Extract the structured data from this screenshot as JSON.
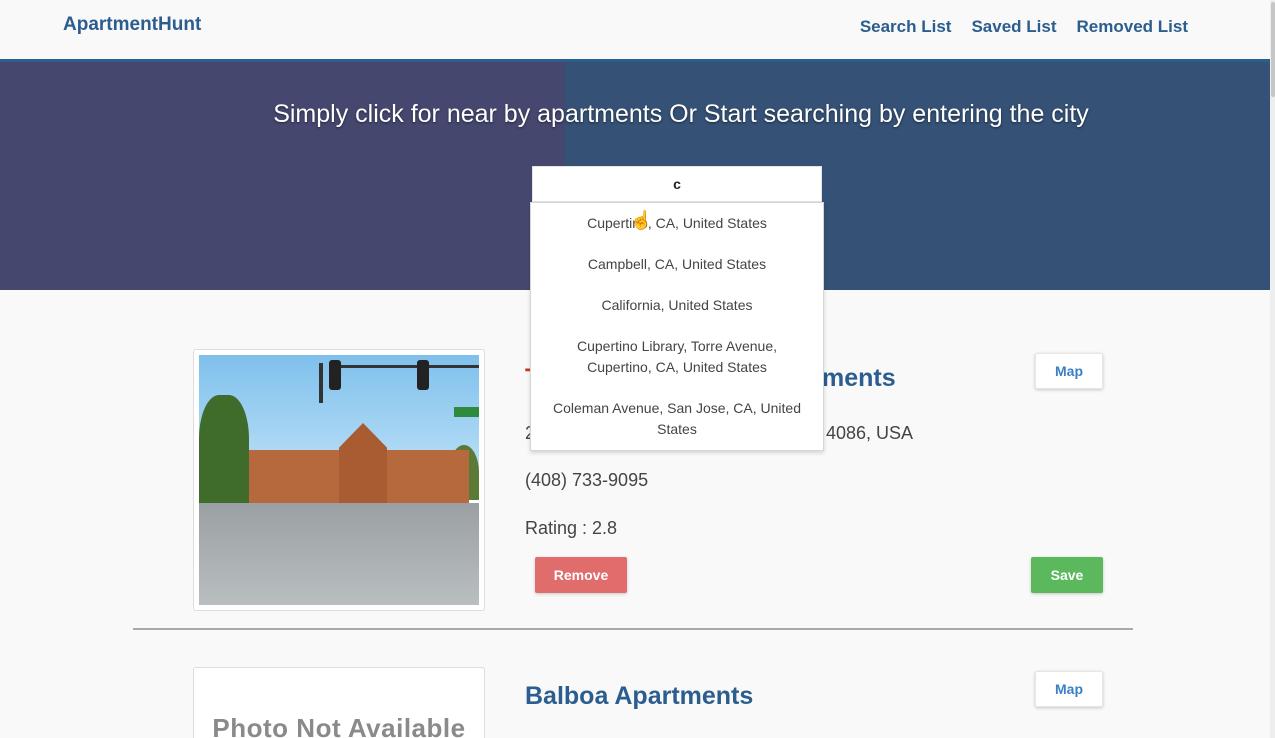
{
  "brand": "ApartmentHunt",
  "nav": [
    "Search List",
    "Saved List",
    "Removed List"
  ],
  "hero": {
    "headline": "Simply click for near by apartments Or Start searching by entering the city"
  },
  "search": {
    "value": "c"
  },
  "suggestions": [
    "Cupertino, CA, United States",
    "Campbell, CA, United States",
    "California, United States",
    "Cupertino Library, Torre Avenue, Cupertino, CA, United States",
    "Coleman Avenue, San Jose, CA, United States"
  ],
  "listings": [
    {
      "title_prefix": "T",
      "title_suffix": "ments",
      "address_prefix": "2",
      "address_suffix": "4086, USA",
      "phone": "(408) 733-9095",
      "rating": "Rating : 2.8",
      "map_label": "Map",
      "remove_label": "Remove",
      "save_label": "Save"
    },
    {
      "title": "Balboa Apartments",
      "photo_placeholder": "Photo Not Available",
      "map_label": "Map"
    }
  ],
  "colors": {
    "brand": "#2c5d8f",
    "hero_bg": "#355175",
    "remove": "#e06c6c",
    "save": "#5cb85c"
  }
}
